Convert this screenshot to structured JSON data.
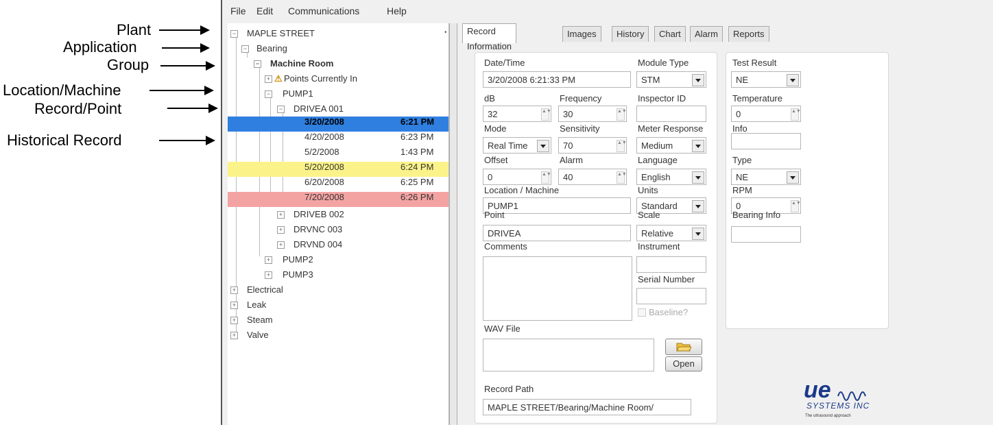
{
  "annotations": [
    {
      "label": "Plant"
    },
    {
      "label": "Application"
    },
    {
      "label": "Group"
    },
    {
      "label": "Location/Machine"
    },
    {
      "label": "Record/Point"
    },
    {
      "label": "Historical Record"
    }
  ],
  "menu": {
    "file": "File",
    "edit": "Edit",
    "communications": "Communications",
    "help": "Help"
  },
  "tree": {
    "plant": "MAPLE STREET",
    "application": "Bearing",
    "group": "Machine Room",
    "points_currently_in": "Points Currently In",
    "machine": "PUMP1",
    "point": "DRIVEA 001",
    "records": [
      {
        "date": "3/20/2008",
        "time": "6:21 PM",
        "highlight": "#2f7fe0"
      },
      {
        "date": "4/20/2008",
        "time": "6:23 PM",
        "highlight": ""
      },
      {
        "date": "5/2/2008",
        "time": "1:43 PM",
        "highlight": ""
      },
      {
        "date": "5/20/2008",
        "time": "6:24 PM",
        "highlight": "#fbf38a"
      },
      {
        "date": "6/20/2008",
        "time": "6:25 PM",
        "highlight": ""
      },
      {
        "date": "7/20/2008",
        "time": "6:26 PM",
        "highlight": "#f4a3a3"
      }
    ],
    "other_points": [
      "DRIVEB 002",
      "DRVNC 003",
      "DRVND 004"
    ],
    "other_machines": [
      "PUMP2",
      "PUMP3"
    ],
    "other_applications": [
      "Electrical",
      "Leak",
      "Steam",
      "Valve"
    ]
  },
  "tabs": [
    "Record Information",
    "Images",
    "History",
    "Chart",
    "Alarm",
    "Reports"
  ],
  "form": {
    "date_time_label": "Date/Time",
    "date_time": "3/20/2008  6:21:33 PM",
    "module_type_label": "Module Type",
    "module_type": "STM",
    "test_result_label": "Test Result",
    "test_result": "NE",
    "db_label": "dB",
    "db": "32",
    "frequency_label": "Frequency",
    "frequency": "30",
    "inspector_label": "Inspector ID",
    "inspector": "",
    "temperature_label": "Temperature",
    "temperature": "0",
    "mode_label": "Mode",
    "mode": "Real Time",
    "sensitivity_label": "Sensitivity",
    "sensitivity": "70",
    "meter_label": "Meter Response",
    "meter": "Medium",
    "info_label": "Info",
    "info": "",
    "offset_label": "Offset",
    "offset": "0",
    "alarm_label": "Alarm",
    "alarm": "40",
    "language_label": "Language",
    "language": "English",
    "type_label": "Type",
    "type": "NE",
    "location_label": "Location / Machine",
    "location": "PUMP1",
    "units_label": "Units",
    "units": "Standard",
    "rpm_label": "RPM",
    "rpm": "0",
    "point_label": "Point",
    "point": "DRIVEA",
    "scale_label": "Scale",
    "scale": "Relative",
    "bearing_info_label": "Bearing Info",
    "bearing_info": "",
    "comments_label": "Comments",
    "instrument_label": "Instrument",
    "serial_label": "Serial Number",
    "baseline_label": "Baseline?",
    "wav_label": "WAV File",
    "open_label": "Open",
    "record_path_label": "Record Path",
    "record_path": "MAPLE STREET/Bearing/Machine Room/"
  },
  "logo": {
    "brand": "ue",
    "company": "SYSTEMS INC",
    "tagline": "The ultrasound approach",
    "color": "#1a3a8a"
  }
}
